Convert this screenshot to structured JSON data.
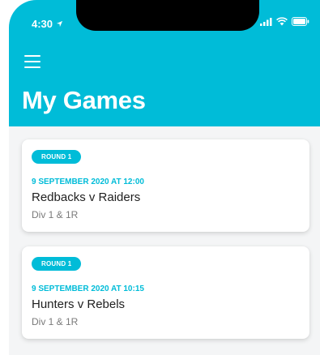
{
  "status_bar": {
    "time": "4:30",
    "icons": [
      "location-arrow-icon",
      "signal-icon",
      "wifi-icon",
      "battery-icon"
    ]
  },
  "header": {
    "title": "My Games",
    "menu_icon": "hamburger-menu-icon"
  },
  "colors": {
    "accent": "#00bcd8",
    "background": "#f4f5f6"
  },
  "games": [
    {
      "round": "ROUND 1",
      "date": "9 SEPTEMBER 2020 AT 12:00",
      "match": "Redbacks v Raiders",
      "division": "Div 1 & 1R"
    },
    {
      "round": "ROUND 1",
      "date": "9 SEPTEMBER 2020 AT 10:15",
      "match": "Hunters v Rebels",
      "division": "Div 1 & 1R"
    }
  ]
}
